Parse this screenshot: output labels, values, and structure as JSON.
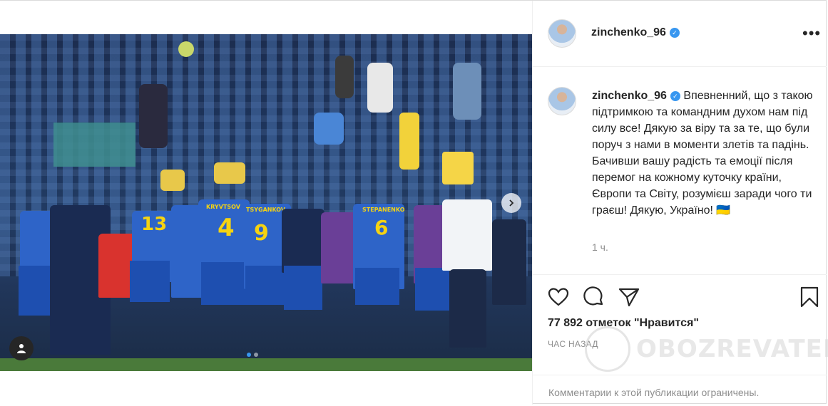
{
  "post": {
    "username": "zinchenko_96",
    "verified": true,
    "more_icon": "more-horizontal-icon",
    "caption": "Впевненний, що з такою підтримкою та командним духом нам під силу все! Дякую за віру та за те, що були поруч з нами в моменти злетів та падінь. Бачивши вашу радість та емоції після перемог на кожному куточку країни, Європи та Світу, розумієш заради чого ти граєш! Дякую, Україно! 🇺🇦",
    "time_ago": "1 ч.",
    "likes": "77 892 отметок \"Нравится\"",
    "timestamp": "ЧАС НАЗАД",
    "comments_limited": "Комментарии к этой публикации ограничены.",
    "watermark": "OBOZREVATEL",
    "jersey_names": [
      "KRYVTSOV",
      "TSYGANKOV",
      "STEPANENKO"
    ],
    "jersey_numbers": [
      "13",
      "4",
      "9",
      "6"
    ],
    "carousel": {
      "total": 2,
      "active": 0
    },
    "icons": [
      "heart-icon",
      "comment-icon",
      "share-icon",
      "bookmark-icon",
      "user-tag-icon",
      "chevron-right-icon",
      "verified-badge-icon"
    ],
    "colors": {
      "verified": "#3897f0",
      "jersey": "#2e64c8",
      "jersey_number": "#f5d312",
      "muted_text": "#8e8e8e"
    }
  }
}
